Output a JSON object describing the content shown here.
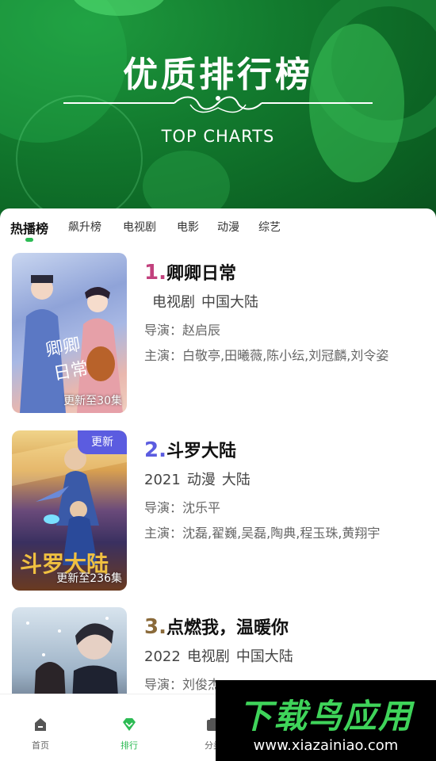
{
  "banner": {
    "title": "优质排行榜",
    "subtitle": "TOP CHARTS"
  },
  "tabs": [
    {
      "label": "热播榜",
      "active": true
    },
    {
      "label": "飙升榜",
      "active": false
    },
    {
      "label": "电视剧",
      "active": false
    },
    {
      "label": "电影",
      "active": false
    },
    {
      "label": "动漫",
      "active": false
    },
    {
      "label": "综艺",
      "active": false
    }
  ],
  "items": [
    {
      "rank": "1.",
      "rank_color": "#c2417d",
      "title": "卿卿日常",
      "year": "",
      "genre": "电视剧",
      "region": "中国大陆",
      "director": "导演：赵启辰",
      "cast": "主演：白敬亭,田曦薇,陈小纭,刘冠麟,刘令姿",
      "update": "更新至30集",
      "badge": "",
      "poster_colors": [
        "#b8c8e8",
        "#7a8cc8",
        "#e8b0a8"
      ],
      "poster_art": "卿卿日常"
    },
    {
      "rank": "2.",
      "rank_color": "#5b5ce0",
      "title": "斗罗大陆",
      "year": "2021",
      "genre": "动漫",
      "region": "大陆",
      "director": "导演：沈乐平",
      "cast": "主演：沈磊,翟巍,吴磊,陶典,程玉珠,黄翔宇",
      "update": "更新至236集",
      "badge": "更新",
      "poster_colors": [
        "#e8c060",
        "#8a5a30",
        "#3a4a8a"
      ],
      "poster_art": "斗罗大陆"
    },
    {
      "rank": "3.",
      "rank_color": "#8a6a3a",
      "title": "点燃我，温暖你",
      "year": "2022",
      "genre": "电视剧",
      "region": "中国大陆",
      "director": "导演：刘俊杰",
      "cast": "",
      "update": "",
      "badge": "",
      "poster_colors": [
        "#c8d8e8",
        "#6a7a90",
        "#2a3040"
      ],
      "poster_art": ""
    }
  ],
  "bottom_nav": [
    {
      "label": "首页",
      "icon": "home-icon",
      "active": false
    },
    {
      "label": "排行",
      "icon": "diamond-icon",
      "active": true
    },
    {
      "label": "分类",
      "icon": "category-icon",
      "active": false
    }
  ],
  "watermark": {
    "title": "下载鸟应用",
    "url": "www.xiazainiao.com"
  },
  "colors": {
    "accent": "#2dbb54",
    "badge": "#5b5ce0"
  }
}
